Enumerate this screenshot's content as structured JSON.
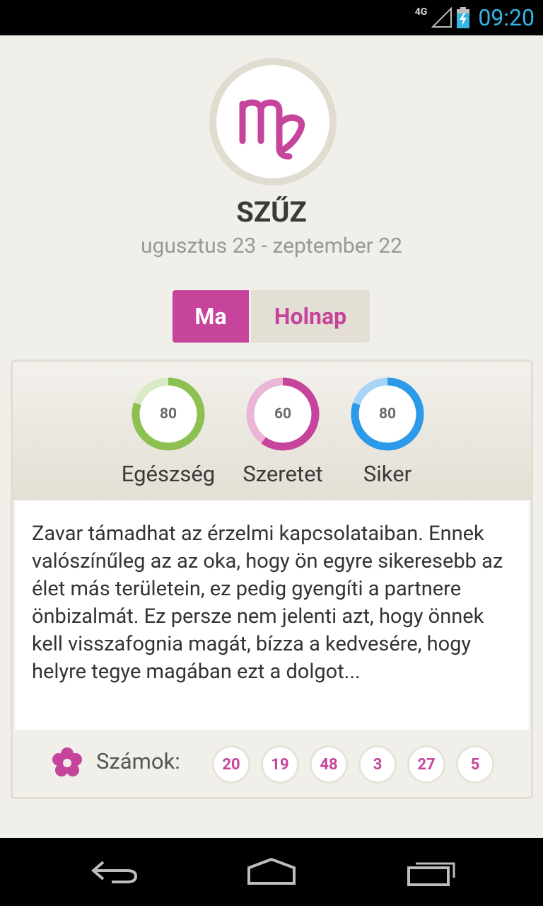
{
  "status_bar": {
    "network": "4G",
    "time": "09:20"
  },
  "sign": {
    "name": "SZŰZ",
    "dates": "ugusztus 23 - zeptember 22",
    "symbol_icon": "virgo-icon"
  },
  "tabs": [
    {
      "label": "Ma",
      "active": true
    },
    {
      "label": "Holnap",
      "active": false
    }
  ],
  "ratings": [
    {
      "label": "Egészség",
      "value": 80,
      "color": "#8cc152",
      "light_color": "#d9eac6"
    },
    {
      "label": "Szeretet",
      "value": 60,
      "color": "#c6449b",
      "light_color": "#ebb6d6"
    },
    {
      "label": "Siker",
      "value": 80,
      "color": "#2b9ae8",
      "light_color": "#a8d5f6"
    }
  ],
  "horoscope_text": "Zavar támadhat az érzelmi kapcsolataiban. Ennek valószínűleg az az oka, hogy ön egyre sikeresebb az élet más területein, ez pedig gyengíti a partnere önbizalmát. Ez persze nem jelenti azt, hogy önnek kell visszafognia magát, bízza a kedvesére, hogy helyre tegye magában ezt a dolgot...",
  "numbers": {
    "label": "Számok:",
    "values": [
      "20",
      "19",
      "48",
      "3",
      "27",
      "5"
    ]
  },
  "colors": {
    "accent": "#c6449b",
    "background": "#f1efe9"
  }
}
